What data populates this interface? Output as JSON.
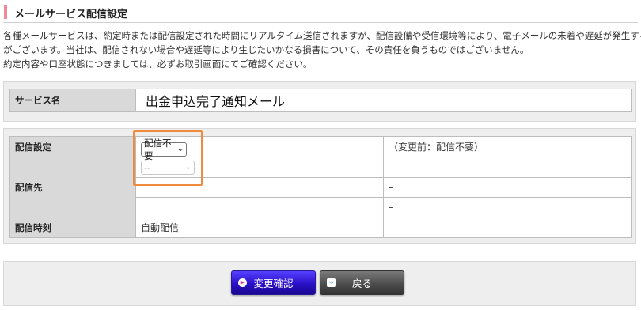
{
  "page": {
    "title": "メールサービス配信設定",
    "notice": [
      "各種メールサービスは、約定時または配信設定された時間にリアルタイム送信されますが、配信設備や受信環境等により、電子メールの未着や遅延が発生する場合",
      "がございます。当社は、配信されない場合や遅延等により生じたいかなる損害について、その責任を負うものではございません。",
      "約定内容や口座状態につきましては、必ずお取引画面にてご確認ください。"
    ]
  },
  "service": {
    "label": "サービス名",
    "value": "出金申込完了通知メール"
  },
  "settings": {
    "delivery_label": "配信設定",
    "delivery_select": "配信不要",
    "delivery_previous": "（変更前：配信不要）",
    "destination_label": "配信先",
    "destination_select": "--",
    "destination_values": [
      "–",
      "–",
      "–"
    ],
    "timing_label": "配信時刻",
    "timing_value": "自動配信"
  },
  "buttons": {
    "confirm": "変更確認",
    "back": "戻る"
  },
  "colors": {
    "accent_bar": "#ee8b9b",
    "highlight_border": "#f08a3c",
    "confirm_button": "#3a22e0",
    "back_button": "#555555"
  }
}
